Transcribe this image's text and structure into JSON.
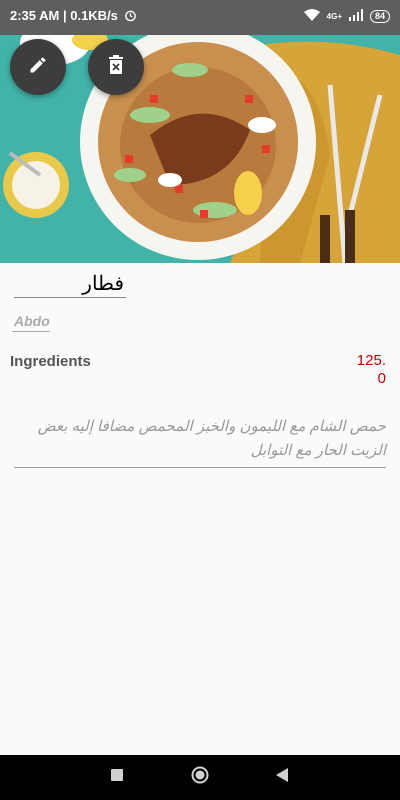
{
  "status_bar": {
    "time_speed": "2:35 AM | 0.1KB/s",
    "alarm_icon": "alarm-icon",
    "wifi_icon": "wifi-icon",
    "network_badge": "4G+",
    "signal_icon": "signal-icon",
    "battery_level": "84"
  },
  "hero": {
    "image_description": "food-photo"
  },
  "actions": {
    "edit_icon": "pencil-icon",
    "delete_icon": "trash-x-icon"
  },
  "meal": {
    "name": "فطار",
    "author": "Abdo",
    "ingredients_label": "Ingredients",
    "price": "125.0",
    "description": "حمص الشام مع الليمون والخبز المحمص مضافا إليه بعض الزيت الحار مع التوابل"
  },
  "nav": {
    "recents_icon": "square-icon",
    "home_icon": "circle-icon",
    "back_icon": "triangle-back-icon"
  },
  "colors": {
    "status_bar": "#5e5e5e",
    "fab": "#3d3d3d",
    "price": "#c00000",
    "nav": "#000000"
  }
}
